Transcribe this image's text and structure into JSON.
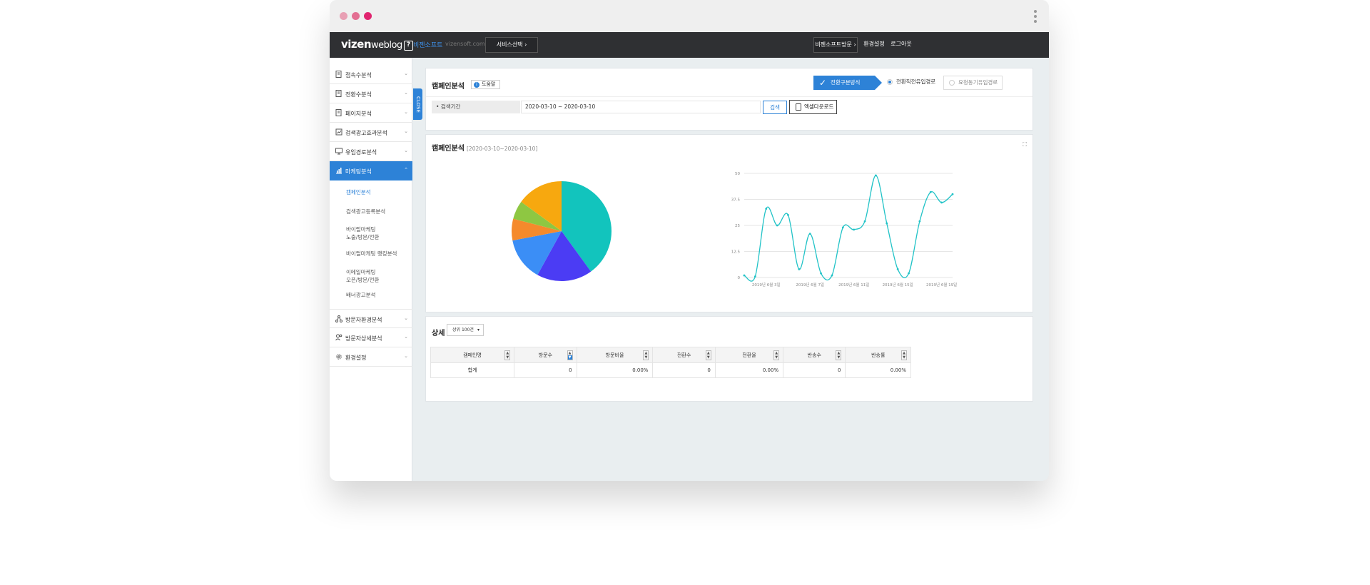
{
  "window": {
    "dots": [
      "#e8a0b4",
      "#e36f92",
      "#e0246f"
    ]
  },
  "topnav": {
    "logo_main": "vizen",
    "logo_sub": "weblog",
    "logo_badge": "?",
    "brand": "비젠소프트",
    "brand_url": "vizensoft.com",
    "service_select": "서비스선택",
    "service_caret": "›",
    "vizensoft_visit": "비젠소프트방문",
    "vizensoft_caret": "›",
    "settings": "환경설정",
    "logout": "로그아웃"
  },
  "sidebar": {
    "close_label": "CLOSE",
    "items": [
      {
        "label": "접속수분석",
        "icon": "document-icon"
      },
      {
        "label": "전환수분석",
        "icon": "document-icon"
      },
      {
        "label": "페이지분석",
        "icon": "document-icon"
      },
      {
        "label": "검색광고효과분석",
        "icon": "report-icon"
      },
      {
        "label": "유입경로분석",
        "icon": "monitor-icon"
      },
      {
        "label": "마케팅분석",
        "icon": "chart-icon"
      },
      {
        "label": "방문자환경분석",
        "icon": "network-icon"
      },
      {
        "label": "방문자상세분석",
        "icon": "users-icon"
      },
      {
        "label": "환경설정",
        "icon": "gear-icon"
      }
    ],
    "subitems": [
      {
        "label": "캠페인분석",
        "label2": ""
      },
      {
        "label": "검색광고등록분석",
        "label2": ""
      },
      {
        "label": "바이럴마케팅",
        "label2": "노출/방문/전환"
      },
      {
        "label": "바이럴마케팅 랭킹분석",
        "label2": ""
      },
      {
        "label": "이메일마케팅",
        "label2": "오픈/방문/전환"
      },
      {
        "label": "배너광고분석",
        "label2": ""
      }
    ],
    "caret": "⌄"
  },
  "header_panel": {
    "title": "캠페인분석",
    "help": "도움말",
    "help_icon_glyph": "i",
    "steps": {
      "active": "전환구분방식",
      "step2": "전환직전유입경로",
      "step3": "요청동기유입경로"
    },
    "filter_label": "• 검색기간",
    "date_value": "2020-03-10 ~ 2020-03-10",
    "search_btn": "검색",
    "excel_btn": "엑셀다운로드"
  },
  "chart_panel": {
    "title": "캠페인분석",
    "date_range": "[2020-03-10~2020-03-10]",
    "expand_glyph": "⛶"
  },
  "chart_data": [
    {
      "type": "pie",
      "categories": [
        "",
        "",
        "",
        "",
        "",
        ""
      ],
      "values": [
        40,
        18,
        14,
        7,
        6,
        15
      ],
      "colors": [
        "#12c4bd",
        "#4b3cf4",
        "#3b8ef6",
        "#f58a2c",
        "#8ec742",
        "#f7a80f"
      ]
    },
    {
      "type": "line",
      "x": [
        "2019년 6월 1일",
        "2019년 6월 2일",
        "2019년 6월 3일",
        "2019년 6월 4일",
        "2019년 6월 5일",
        "2019년 6월 6일",
        "2019년 6월 7일",
        "2019년 6월 8일",
        "2019년 6월 9일",
        "2019년 6월 10일",
        "2019년 6월 11일",
        "2019년 6월 12일",
        "2019년 6월 13일",
        "2019년 6월 14일",
        "2019년 6월 15일",
        "2019년 6월 16일",
        "2019년 6월 17일",
        "2019년 6월 18일",
        "2019년 6월 19일",
        "2019년 6월 20일"
      ],
      "values": [
        1,
        0.5,
        33,
        25,
        30,
        4,
        21,
        2,
        1,
        24,
        23,
        27,
        49,
        26,
        4,
        2,
        27,
        41,
        36,
        40
      ],
      "xticks": [
        "2019년 6월 3일",
        "2019년 6월 7일",
        "2019년 6월 11일",
        "2019년 6월 15일",
        "2019년 6월 19일"
      ],
      "yticks": [
        "0",
        "12.5",
        "25",
        "37.5",
        "50"
      ],
      "ylim": [
        0,
        50
      ],
      "color": "#22c3c7",
      "grid": true
    }
  ],
  "detail_panel": {
    "title": "상세",
    "select_value": "상위 100건",
    "select_caret": "▾",
    "columns": [
      "캠페인명",
      "방문수",
      "방문비율",
      "전환수",
      "전환율",
      "반송수",
      "반송률"
    ],
    "total_row": [
      "합계",
      "0",
      "0.00%",
      "0",
      "0.00%",
      "0",
      "0.00%"
    ],
    "sort_up": "▲",
    "sort_down": "▼"
  }
}
